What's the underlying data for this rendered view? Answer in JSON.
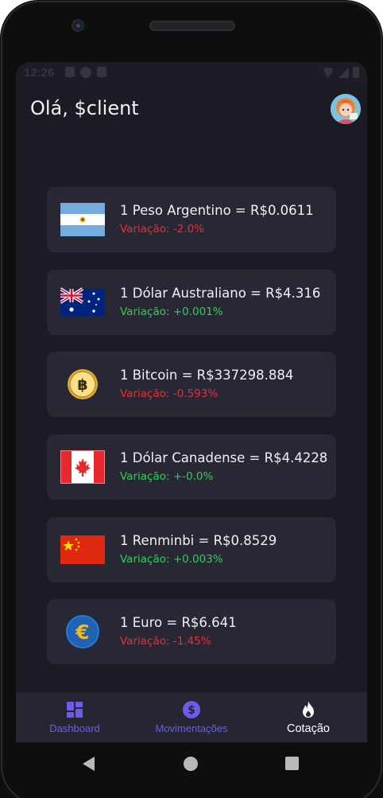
{
  "status_bar": {
    "time": "12:26"
  },
  "header": {
    "greeting": "Olá, $client"
  },
  "rates": [
    {
      "icon": "argentina-flag-icon",
      "text": "1 Peso Argentino = R$0.0611",
      "variation": "Variação: -2.0%",
      "trend": "negative"
    },
    {
      "icon": "australia-flag-icon",
      "text": "1 Dólar Australiano = R$4.316",
      "variation": "Variação: +0.001%",
      "trend": "positive"
    },
    {
      "icon": "bitcoin-icon",
      "text": "1 Bitcoin = R$337298.884",
      "variation": "Variação: -0.593%",
      "trend": "negative"
    },
    {
      "icon": "canada-flag-icon",
      "text": "1 Dólar Canadense = R$4.4228",
      "variation": "Variação: +-0.0%",
      "trend": "positive"
    },
    {
      "icon": "china-flag-icon",
      "text": "1 Renminbi = R$0.8529",
      "variation": "Variação: +0.003%",
      "trend": "positive"
    },
    {
      "icon": "euro-icon",
      "text": "1 Euro = R$6.641",
      "variation": "Variação: -1.45%",
      "trend": "negative"
    }
  ],
  "bottom_nav": {
    "items": [
      {
        "label": "Dashboard",
        "icon": "dashboard-icon",
        "active": false
      },
      {
        "label": "Movimentações",
        "icon": "dollar-icon",
        "active": false
      },
      {
        "label": "Cotação",
        "icon": "fire-icon",
        "active": true
      }
    ]
  },
  "colors": {
    "background": "#1b1b24",
    "card": "#282834",
    "accent": "#6c5ce7",
    "negative": "#e2303f",
    "positive": "#37c95b"
  }
}
